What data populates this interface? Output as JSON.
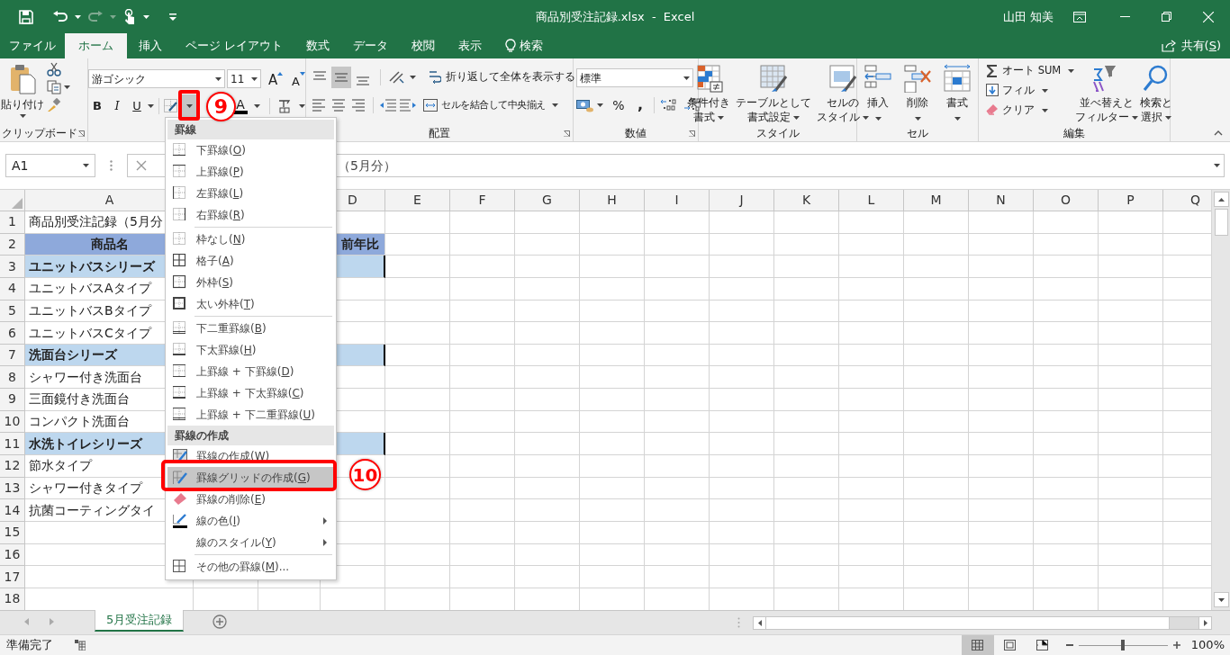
{
  "window": {
    "title": "商品別受注記録.xlsx  -  Excel",
    "user": "山田 知美"
  },
  "tabs": [
    {
      "label": "ファイル",
      "selected": false
    },
    {
      "label": "ホーム",
      "selected": true
    },
    {
      "label": "挿入",
      "selected": false
    },
    {
      "label": "ページ レイアウト",
      "selected": false
    },
    {
      "label": "数式",
      "selected": false
    },
    {
      "label": "データ",
      "selected": false
    },
    {
      "label": "校閲",
      "selected": false
    },
    {
      "label": "表示",
      "selected": false
    }
  ],
  "tell_me": "検索",
  "share": "共有(S)",
  "ribbon": {
    "clipboard": {
      "label": "クリップボード",
      "paste": "貼り付け"
    },
    "font": {
      "font_name": "游ゴシック",
      "font_size": "11",
      "grow": "A",
      "shrink": "A",
      "bold": "B",
      "italic": "I",
      "underline": "U",
      "font_color": "A"
    },
    "alignment": {
      "label": "配置",
      "wrap": "折り返して全体を表示する",
      "merge": "セルを結合して中央揃え"
    },
    "number": {
      "label": "数値",
      "format": "標準",
      "percent": "%",
      "comma": ","
    },
    "styles": {
      "label": "スタイル",
      "buttons": [
        {
          "lines": [
            "条件付き",
            "書式"
          ]
        },
        {
          "lines": [
            "テーブルとして",
            "書式設定"
          ]
        },
        {
          "lines": [
            "セルの",
            "スタイル"
          ]
        }
      ]
    },
    "cells": {
      "label": "セル",
      "buttons": [
        {
          "lines": [
            "挿入"
          ]
        },
        {
          "lines": [
            "削除"
          ]
        },
        {
          "lines": [
            "書式"
          ]
        }
      ]
    },
    "editing": {
      "label": "編集",
      "small": [
        "オート SUM",
        "フィル",
        "クリア"
      ],
      "buttons": [
        {
          "lines": [
            "並べ替えと",
            "フィルター"
          ]
        },
        {
          "lines": [
            "検索と",
            "選択"
          ]
        }
      ]
    }
  },
  "formula_bar": {
    "name_box": "A1",
    "content": "（5月分）"
  },
  "grid": {
    "columns": [
      "A",
      "D",
      "E",
      "F",
      "G",
      "H",
      "I",
      "J",
      "K",
      "L",
      "M",
      "N",
      "O",
      "P",
      "Q"
    ],
    "rows": [
      {
        "number": "1",
        "kind": "title",
        "A": "商品別受注記録（5月分"
      },
      {
        "number": "2",
        "kind": "header",
        "A": "商品名",
        "D": "前年比"
      },
      {
        "number": "3",
        "kind": "group",
        "A": "ユニットバスシリーズ"
      },
      {
        "number": "4",
        "kind": "item",
        "A": "ユニットバスAタイプ"
      },
      {
        "number": "5",
        "kind": "item",
        "A": "ユニットバスBタイプ"
      },
      {
        "number": "6",
        "kind": "item",
        "A": "ユニットバスCタイプ"
      },
      {
        "number": "7",
        "kind": "group",
        "A": "洗面台シリーズ"
      },
      {
        "number": "8",
        "kind": "item",
        "A": "シャワー付き洗面台"
      },
      {
        "number": "9",
        "kind": "item",
        "A": "三面鏡付き洗面台"
      },
      {
        "number": "10",
        "kind": "item",
        "A": "コンパクト洗面台"
      },
      {
        "number": "11",
        "kind": "group",
        "A": "水洗トイレシリーズ"
      },
      {
        "number": "12",
        "kind": "item",
        "A": "節水タイプ"
      },
      {
        "number": "13",
        "kind": "item",
        "A": "シャワー付きタイプ"
      },
      {
        "number": "14",
        "kind": "item",
        "A": "抗菌コーティングタイ"
      },
      {
        "number": "15",
        "kind": "empty"
      },
      {
        "number": "16",
        "kind": "empty"
      },
      {
        "number": "17",
        "kind": "empty"
      },
      {
        "number": "18",
        "kind": "empty"
      }
    ]
  },
  "border_menu": [
    {
      "kind": "header",
      "label": "罫線"
    },
    {
      "kind": "item",
      "label": "下罫線(O)",
      "selected": false,
      "submenu": false
    },
    {
      "kind": "item",
      "label": "上罫線(P)",
      "selected": false,
      "submenu": false
    },
    {
      "kind": "item",
      "label": "左罫線(L)",
      "selected": false,
      "submenu": false
    },
    {
      "kind": "item",
      "label": "右罫線(R)",
      "selected": false,
      "submenu": false
    },
    {
      "kind": "separator"
    },
    {
      "kind": "item",
      "label": "枠なし(N)",
      "selected": false,
      "submenu": false
    },
    {
      "kind": "item",
      "label": "格子(A)",
      "selected": false,
      "submenu": false
    },
    {
      "kind": "item",
      "label": "外枠(S)",
      "selected": false,
      "submenu": false
    },
    {
      "kind": "item",
      "label": "太い外枠(T)",
      "selected": false,
      "submenu": false
    },
    {
      "kind": "separator"
    },
    {
      "kind": "item",
      "label": "下二重罫線(B)",
      "selected": false,
      "submenu": false
    },
    {
      "kind": "item",
      "label": "下太罫線(H)",
      "selected": false,
      "submenu": false
    },
    {
      "kind": "item",
      "label": "上罫線 + 下罫線(D)",
      "selected": false,
      "submenu": false
    },
    {
      "kind": "item",
      "label": "上罫線 + 下太罫線(C)",
      "selected": false,
      "submenu": false
    },
    {
      "kind": "item",
      "label": "上罫線 + 下二重罫線(U)",
      "selected": false,
      "submenu": false
    },
    {
      "kind": "header",
      "label": "罫線の作成"
    },
    {
      "kind": "item",
      "label": "罫線の作成(W)",
      "selected": false,
      "submenu": false
    },
    {
      "kind": "item",
      "label": "罫線グリッドの作成(G)",
      "selected": true,
      "submenu": false
    },
    {
      "kind": "item",
      "label": "罫線の削除(E)",
      "selected": false,
      "submenu": false
    },
    {
      "kind": "item",
      "label": "線の色(I)",
      "selected": false,
      "submenu": true
    },
    {
      "kind": "item",
      "label": "線のスタイル(Y)",
      "selected": false,
      "submenu": true
    },
    {
      "kind": "separator"
    },
    {
      "kind": "item",
      "label": "その他の罫線(M)...",
      "selected": false,
      "submenu": false
    }
  ],
  "callouts": [
    {
      "number": "9"
    },
    {
      "number": "10"
    }
  ],
  "sheet_tabs": [
    {
      "label": "5月受注記録",
      "selected": true
    }
  ],
  "status_bar": {
    "status": "準備完了",
    "view_buttons": [
      {
        "selected": true
      },
      {
        "selected": false
      },
      {
        "selected": false
      }
    ],
    "zoom": {
      "level": 0.5,
      "reading": "100%"
    }
  }
}
